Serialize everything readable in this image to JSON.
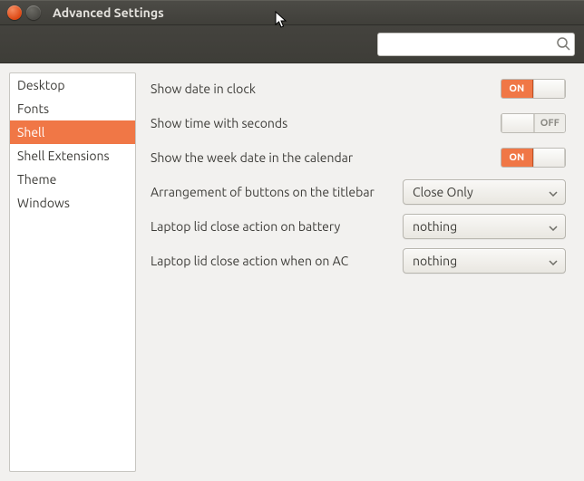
{
  "window": {
    "title": "Advanced Settings"
  },
  "search": {
    "value": ""
  },
  "sidebar": {
    "items": [
      {
        "label": "Desktop",
        "selected": false
      },
      {
        "label": "Fonts",
        "selected": false
      },
      {
        "label": "Shell",
        "selected": true
      },
      {
        "label": "Shell Extensions",
        "selected": false
      },
      {
        "label": "Theme",
        "selected": false
      },
      {
        "label": "Windows",
        "selected": false
      }
    ]
  },
  "settings": {
    "toggles": [
      {
        "label": "Show date in clock",
        "state": "ON"
      },
      {
        "label": "Show time with seconds",
        "state": "OFF"
      },
      {
        "label": "Show the week date in the calendar",
        "state": "ON"
      }
    ],
    "dropdowns": [
      {
        "label": "Arrangement of buttons on the titlebar",
        "value": "Close Only"
      },
      {
        "label": "Laptop lid close action on battery",
        "value": "nothing"
      },
      {
        "label": "Laptop lid close action when on AC",
        "value": "nothing"
      }
    ]
  },
  "labels": {
    "on": "ON",
    "off": "OFF"
  }
}
